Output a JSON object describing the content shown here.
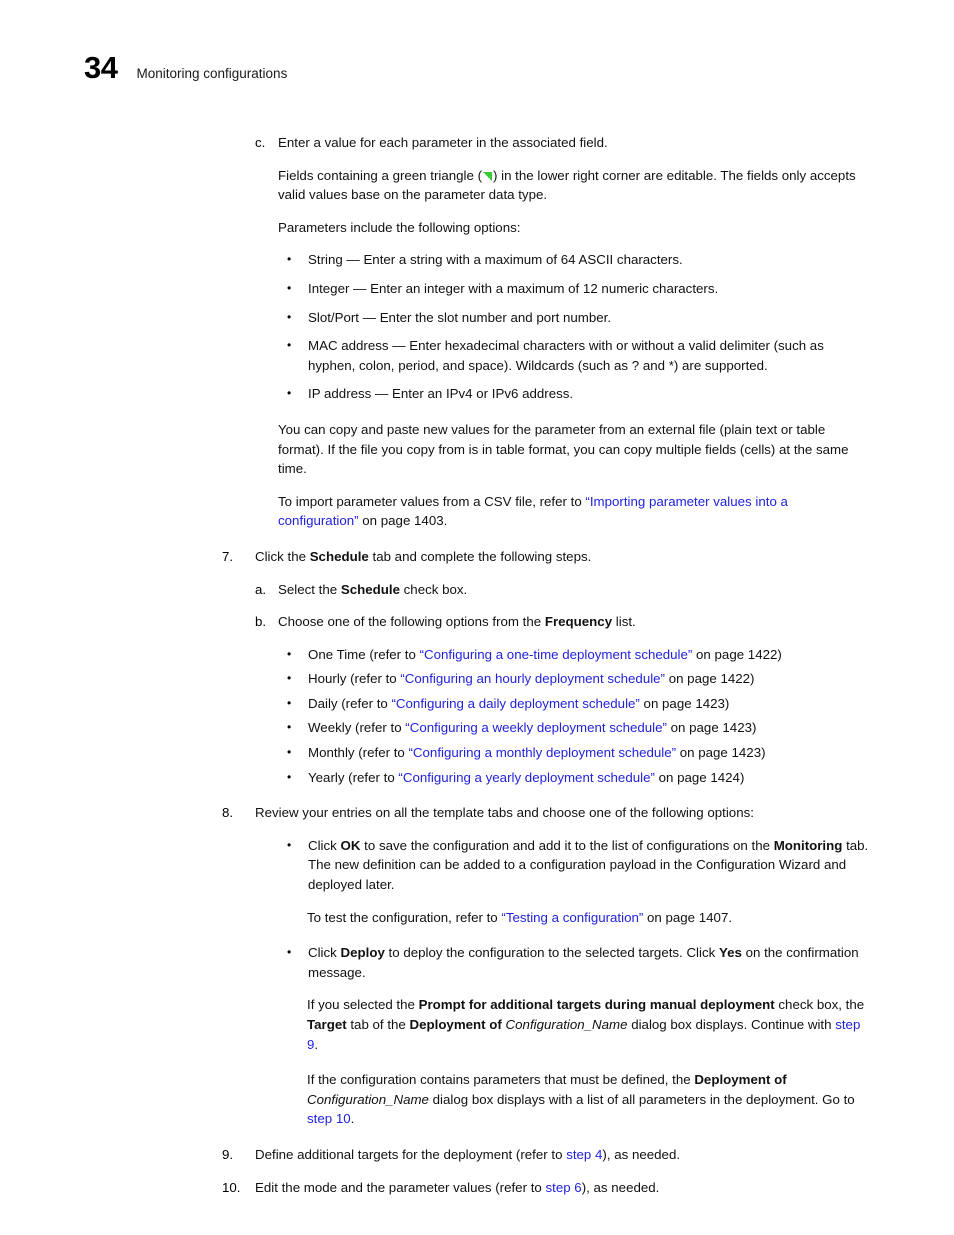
{
  "header": {
    "page_number": "34",
    "title": "Monitoring configurations"
  },
  "colors": {
    "link": "#2222dd",
    "text": "#111111",
    "triangle": "#33cc33"
  },
  "step_c": {
    "marker": "c.",
    "text": "Enter a value for each parameter in the associated field.",
    "para_editable_1": "Fields containing a green triangle (",
    "para_editable_2": ") in the lower right corner are editable. The fields only accepts valid values base on the parameter data type.",
    "para_options_intro": "Parameters include the following options:",
    "bullets": [
      {
        "term": "String",
        "dash": " — ",
        "rest": "Enter a string with a maximum of 64 ASCII characters."
      },
      {
        "term": "Integer",
        "dash": " — ",
        "rest": "Enter an integer with a maximum of 12 numeric characters."
      },
      {
        "term": "Slot/Port",
        "dash": " — ",
        "rest": "Enter the slot number and port number."
      },
      {
        "term": "MAC address",
        "dash": " — ",
        "rest": "Enter hexadecimal characters with or without a valid delimiter (such as hyphen, colon, period, and space). Wildcards (such as ? and *) are supported."
      },
      {
        "term": "IP address",
        "dash": " — ",
        "rest": "Enter an IPv4 or IPv6 address."
      }
    ],
    "para_copy_paste": "You can copy and paste new values for the parameter from an external file (plain text or table format). If the file you copy from is in table format, you can copy multiple fields (cells) at the same time.",
    "para_csv_pre": "To import parameter values from a CSV file, refer to ",
    "para_csv_link": "“Importing parameter values into a configuration”",
    "para_csv_post": " on page 1403."
  },
  "step_7": {
    "marker": "7.",
    "text_pre": "Click the ",
    "text_bold": "Schedule",
    "text_post": " tab and complete the following steps.",
    "sub_a": {
      "marker": "a.",
      "text_pre": "Select the ",
      "text_bold": "Schedule",
      "text_post": " check box."
    },
    "sub_b": {
      "marker": "b.",
      "text_pre": "Choose one of the following options from the ",
      "text_bold": "Frequency",
      "text_post": " list."
    },
    "frequency_bullets": [
      {
        "pre": "One Time (refer to ",
        "link": "“Configuring a one-time deployment schedule”",
        "post": " on page 1422)"
      },
      {
        "pre": "Hourly (refer to ",
        "link": "“Configuring an hourly deployment schedule”",
        "post": " on page 1422)"
      },
      {
        "pre": "Daily (refer to ",
        "link": "“Configuring a daily deployment schedule”",
        "post": " on page 1423)"
      },
      {
        "pre": "Weekly (refer to ",
        "link": "“Configuring a weekly deployment schedule”",
        "post": " on page 1423)"
      },
      {
        "pre": "Monthly (refer to ",
        "link": "“Configuring a monthly deployment schedule”",
        "post": " on page 1423)"
      },
      {
        "pre": "Yearly (refer to ",
        "link": "“Configuring a yearly deployment schedule”",
        "post": " on page 1424)"
      }
    ]
  },
  "step_8": {
    "marker": "8.",
    "text": "Review your entries on all the template tabs and choose one of the following options:",
    "bullet_ok": {
      "pre": "Click ",
      "bold_ok": "OK",
      "mid": " to save the configuration and add it to the list of configurations on the ",
      "bold_monitoring": "Monitoring",
      "post": " tab. The new definition can be added to a configuration payload in the Configuration Wizard and deployed later."
    },
    "para_test_pre": "To test the configuration, refer to ",
    "para_test_link": "“Testing a configuration”",
    "para_test_post": " on page 1407.",
    "bullet_deploy": {
      "pre": "Click ",
      "bold_deploy": "Deploy",
      "mid": " to deploy the configuration to the selected targets. Click ",
      "bold_yes": "Yes",
      "post": " on the confirmation message."
    },
    "para_prompt_pre": "If you selected the ",
    "para_prompt_bold1": "Prompt for additional targets during manual deployment",
    "para_prompt_mid1": " check box, the ",
    "para_prompt_bold2": "Target",
    "para_prompt_mid2": " tab of the ",
    "para_prompt_bold3": "Deployment of",
    "para_prompt_italic": " Configuration_Name",
    "para_prompt_mid3": " dialog box displays. Continue with ",
    "para_prompt_link": "step 9",
    "para_prompt_post": ".",
    "para_params_pre": "If the configuration contains parameters that must be defined, the ",
    "para_params_bold": "Deployment of",
    "para_params_italic": " Configuration_Name",
    "para_params_mid": " dialog box displays with a list of all parameters in the deployment. Go to ",
    "para_params_link": "step 10",
    "para_params_post": "."
  },
  "step_9": {
    "marker": "9.",
    "pre": "Define additional targets for the deployment (refer to ",
    "link": "step 4",
    "post": "), as needed."
  },
  "step_10": {
    "marker": "10.",
    "pre": "Edit the mode and the parameter values (refer to ",
    "link": "step 6",
    "post": "), as needed."
  },
  "bullet_glyph": "•"
}
